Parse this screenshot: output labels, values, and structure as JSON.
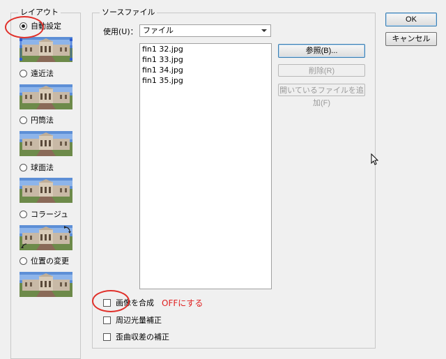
{
  "layout_group": {
    "title": "レイアウト",
    "options": [
      {
        "label": "自動設定",
        "selected": true
      },
      {
        "label": "遠近法",
        "selected": false
      },
      {
        "label": "円筒法",
        "selected": false
      },
      {
        "label": "球面法",
        "selected": false
      },
      {
        "label": "コラージュ",
        "selected": false
      },
      {
        "label": "位置の変更",
        "selected": false
      }
    ]
  },
  "source_group": {
    "title": "ソースファイル",
    "use_label": "使用(U)：",
    "use_value": "ファイル",
    "files": [
      "fin1 32.jpg",
      "fin1 33.jpg",
      "fin1 34.jpg",
      "fin1 35.jpg"
    ],
    "browse_label": "参照(B)...",
    "remove_label": "削除(R)",
    "add_open_label": "開いているファイルを追加(F)"
  },
  "options": {
    "blend_label": "画像を合成",
    "vignette_label": "周辺光量補正",
    "distortion_label": "歪曲収差の補正"
  },
  "annotation": {
    "text": "OFFにする",
    "color": "#e02020"
  },
  "dialog": {
    "ok_label": "OK",
    "cancel_label": "キャンセル"
  }
}
